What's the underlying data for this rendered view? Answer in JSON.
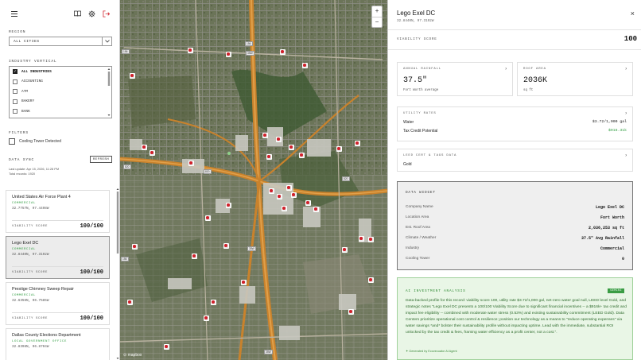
{
  "sidebar": {
    "region_label": "REGION",
    "region_value": "ALL CITIES",
    "industry_label": "INDUSTRY VERTICAL",
    "industries": [
      {
        "label": "ALL INDUSTRIES",
        "checked": true
      },
      {
        "label": "ACCOUNTING",
        "checked": false
      },
      {
        "label": "ATM",
        "checked": false
      },
      {
        "label": "BAKERY",
        "checked": false
      },
      {
        "label": "BANK",
        "checked": false
      }
    ],
    "filters_label": "FILTERS",
    "filter_cooling": "Cooling Tower Detected",
    "sync_label": "DATA SYNC",
    "refresh_label": "REFRESH",
    "last_update": "Last update: Apr 15, 2026, 11:28 PM",
    "total_records": "Total records: 1920",
    "cards": [
      {
        "name": "United States Air Force Plant 4",
        "category": "COMMERCIAL",
        "coords": "32.7757N, 97.4498W",
        "score_label": "VIABILITY SCORE",
        "score": "100/100"
      },
      {
        "name": "Lego Exel DC",
        "category": "COMMERCIAL",
        "coords": "32.8440N, 97.3192W",
        "score_label": "VIABILITY SCORE",
        "score": "100/100"
      },
      {
        "name": "Prestige Chimney Sweep Repair",
        "category": "COMMERCIAL",
        "coords": "32.6356N, 96.7585W",
        "score_label": "VIABILITY SCORE",
        "score": "100/100"
      },
      {
        "name": "Dallas County Elections Department",
        "category": "LOCAL GOVERNMENT OFFICE",
        "coords": "32.8398N, 96.8704W",
        "score_label": "VIABILITY SCORE",
        "score": "100/100"
      }
    ]
  },
  "map": {
    "zoom_in": "+",
    "zoom_out": "−",
    "attribution": "mapbox",
    "shields": [
      "156",
      "156",
      "35W",
      "820",
      "820",
      "820",
      "156",
      "35W",
      "35W"
    ]
  },
  "detail": {
    "title": "Lego Exel DC",
    "coords": "32.8440N, 97.3192W",
    "close": "×",
    "viability_label": "VIABILITY SCORE",
    "viability_value": "100",
    "rainfall_label": "ANNUAL RAINFALL",
    "rainfall_value": "37.5\"",
    "rainfall_sub": "Fort Worth average",
    "roof_label": "ROOF AREA",
    "roof_value": "2036K",
    "roof_sub": "sq ft",
    "utility_label": "UTILITY RATES",
    "water_label": "Water",
    "water_value": "$3.72/1,000 gal",
    "tax_label": "Tax Credit Potential",
    "tax_value": "$916.31k",
    "leed_label": "LEED CERT & TAGS DATA",
    "leed_value": "Gold",
    "widget_title": "DATA WIDGET",
    "widget_rows": [
      {
        "label": "Company Name",
        "value": "Lego Exel DC"
      },
      {
        "label": "Location Area",
        "value": "Fort Worth"
      },
      {
        "label": "Est. Roof Area",
        "value": "2,036,253 sq ft"
      },
      {
        "label": "Climate / Weather",
        "value": "37.5\" Avg Rainfall"
      },
      {
        "label": "Industry",
        "value": "Commercial"
      },
      {
        "label": "Cooling Tower",
        "value": "0"
      }
    ],
    "ai_title": "AI INVESTMENT ANALYSIS",
    "ai_badge": "GEMINI",
    "ai_body": "Data-backed profile for this record: viability score 100, utility rate $3.72/1,000 gal, net-zero water goal null, LEED level Gold, and strategic notes \"Lego Exel DC presents a 100/100 Viability Score due to significant financial incentives -- a $916k+ tax credit and impact fee eligibility -- combined with moderate water stress (0.53%) and existing sustainability commitment (LEED Gold). Data Centers prioritize operational cost control & resilience; position our technology as a means to \"reduce operating expenses\" via water savings *and* bolster their sustainability profile without impacting uptime. Lead with the immediate, substantial ROI unlocked by the tax credit & fees, framing water efficiency as a profit center, not a cost.\".",
    "ai_footer": "✦ Generated by Ecovecuator AI Agent"
  },
  "colors": {
    "accent_green": "#2e9c3f",
    "logout_red": "#d0202a",
    "pin_red": "#d0202a"
  }
}
